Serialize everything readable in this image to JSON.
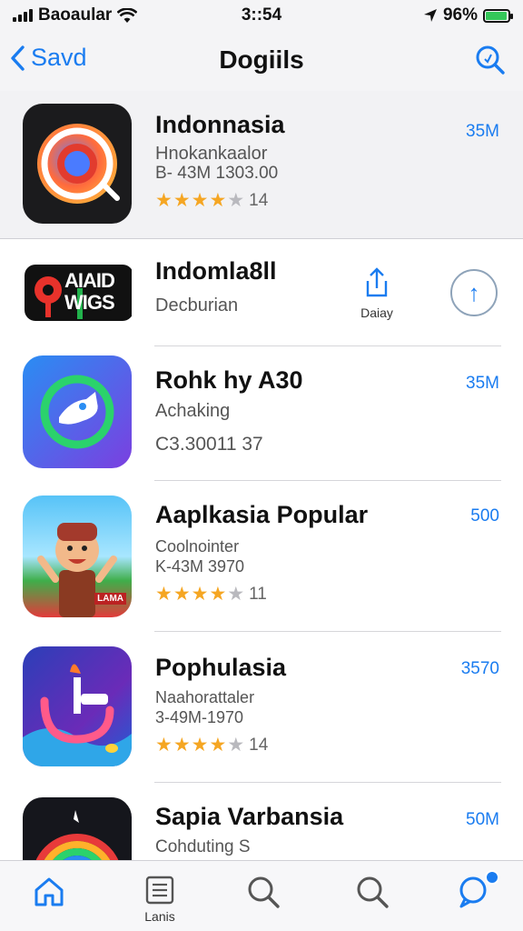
{
  "status_bar": {
    "carrier": "Baoaular",
    "time": "3::54",
    "battery": "96%",
    "battery_level": 0.96
  },
  "nav": {
    "back_label": "Savd",
    "title": "Dogiils"
  },
  "apps": [
    {
      "name": "Indonnasia",
      "subtitle": "Hnokankaalor",
      "meta": "B- 43M 1303.00",
      "rating": 4,
      "rating_count": "14",
      "size": "35M"
    },
    {
      "name": "Indomla8ll",
      "subtitle": "Decburian",
      "share_label": "Daiay",
      "logo_text": "AIAID WIGS"
    },
    {
      "name": "Rohk hy A30",
      "subtitle": "Achaking",
      "meta": "C3.30011 37",
      "size": "35M"
    },
    {
      "name": "Aaplkasia Popular",
      "subtitle": "Coolnointer",
      "meta": "K-43M 3970",
      "rating": 4,
      "rating_count": "11",
      "size": "500",
      "icon_tag": "LAMA"
    },
    {
      "name": "Pophulasia",
      "subtitle": "Naahorattaler",
      "meta": "3-49M-1970",
      "rating": 4,
      "rating_count": "14",
      "size": "3570"
    },
    {
      "name": "Sapia Varbansia",
      "subtitle": "Cohduting S",
      "size": "50M"
    }
  ],
  "tabs": [
    {
      "name": "home",
      "label": "",
      "icon": "home-icon"
    },
    {
      "name": "lists",
      "label": "Lanis",
      "icon": "list-icon"
    },
    {
      "name": "search",
      "label": "",
      "icon": "search-icon"
    },
    {
      "name": "search-2",
      "label": "",
      "icon": "search-icon"
    },
    {
      "name": "chat",
      "label": "",
      "icon": "chat-search-icon",
      "badge": true
    }
  ],
  "colors": {
    "accent": "#1a7cf0",
    "star": "#f5a623",
    "header_bg": "#f4f4f6"
  }
}
